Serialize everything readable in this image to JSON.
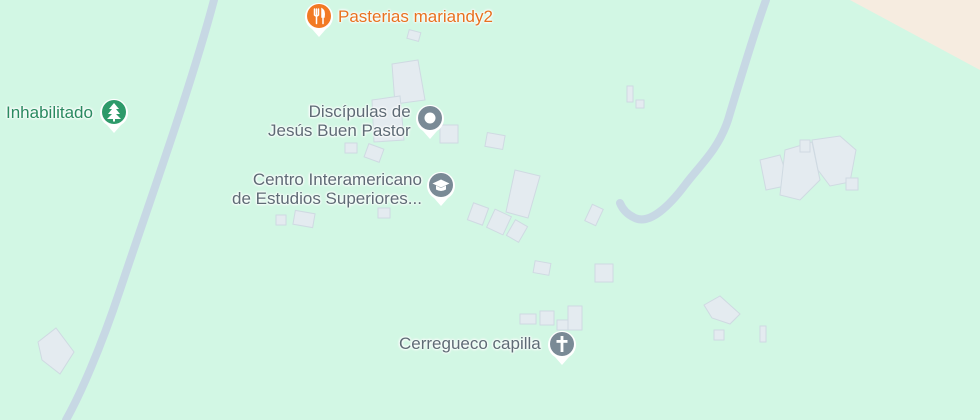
{
  "map": {
    "colors": {
      "land": "#d2f7e4",
      "sand": "#f6ece0",
      "road": "#c7d8e4",
      "building": "#e4ebf0",
      "building_stroke": "#cfdae2"
    }
  },
  "pois": [
    {
      "id": "pasterias",
      "label": "Pasterias mariandy2",
      "icon": "restaurant-icon",
      "color": "#f27a24"
    },
    {
      "id": "inhabilitado",
      "label": "Inhabilitado",
      "icon": "park-tree-icon",
      "color": "#2e9a6a"
    },
    {
      "id": "disc",
      "label_lines": [
        "Discípulas de",
        "Jesús Buen Pastor"
      ],
      "icon": "place-dot-icon",
      "color": "#7a8a96"
    },
    {
      "id": "centro",
      "label_lines": [
        "Centro Interamericano",
        "de Estudios Superiores..."
      ],
      "icon": "graduation-cap-icon",
      "color": "#7a8a96"
    },
    {
      "id": "capilla",
      "label": "Cerregueco capilla",
      "icon": "cross-icon",
      "color": "#7a8a96"
    }
  ]
}
